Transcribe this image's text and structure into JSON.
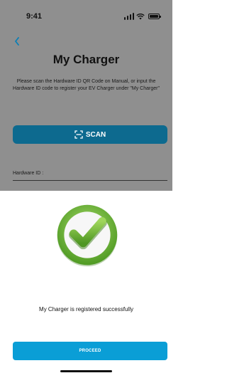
{
  "status_bar": {
    "time": "9:41",
    "icons": [
      "signal-icon",
      "wifi-icon",
      "battery-icon"
    ]
  },
  "header": {
    "back_icon": "chevron-left-icon",
    "title": "My Charger"
  },
  "instructions": {
    "text": "Please scan the Hardware ID QR Code on Manual, or input the Hardware ID code to register your EV Charger under \"My Charger\""
  },
  "scan_button": {
    "icon": "scan-icon",
    "label": "SCAN"
  },
  "hardware_field": {
    "label": "Hardware ID :",
    "value": ""
  },
  "success_sheet": {
    "icon": "check-circle-icon",
    "message": "My Charger is registered successfully",
    "proceed_label": "PROCEED"
  },
  "colors": {
    "overlay": "#8f8f8f",
    "scan_button_bg": "#0d6a8f",
    "proceed_button_bg": "#0a9ed6",
    "check_green": "#7cc242",
    "back_arrow": "#0a7fb6"
  }
}
